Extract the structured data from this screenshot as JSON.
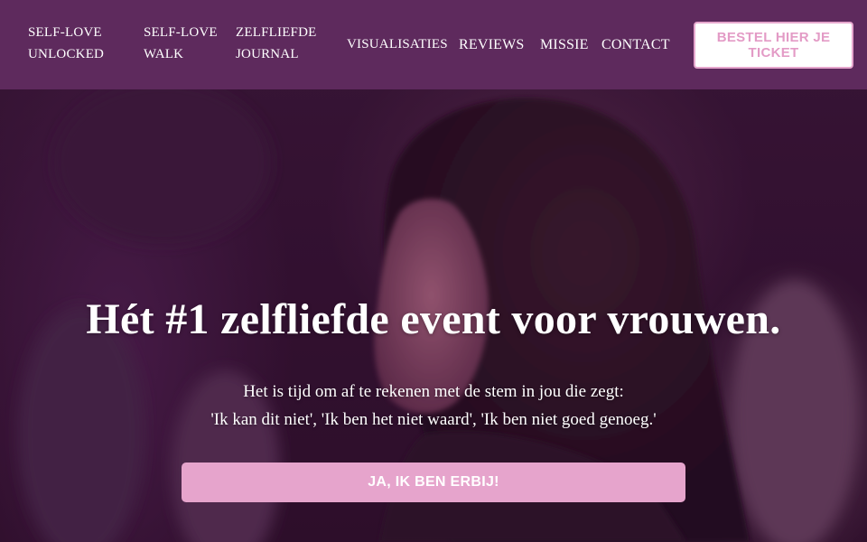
{
  "nav": {
    "items": [
      {
        "lines": [
          "SELF-LOVE",
          "UNLOCKED"
        ]
      },
      {
        "lines": [
          "SELF-LOVE",
          "WALK"
        ]
      },
      {
        "lines": [
          "ZELFLIEFDE",
          "JOURNAL"
        ]
      },
      {
        "lines": [
          "VISUALISATIES"
        ]
      },
      {
        "lines": [
          "REVIEWS"
        ]
      },
      {
        "lines": [
          "MISSIE"
        ]
      },
      {
        "lines": [
          "CONTACT"
        ]
      }
    ],
    "ticket_button": "BESTEL HIER JE TICKET"
  },
  "hero": {
    "headline": "Hét #1 zelfliefde event voor vrouwen.",
    "subtext_line1": "Het is tijd om af te rekenen met de stem in jou die zegt:",
    "subtext_line2": "'Ik kan dit niet', 'Ik ben het niet waard', 'Ik ben niet goed genoeg.'",
    "cta": "JA, IK BEN ERBIJ!"
  },
  "colors": {
    "navbar": "#5e2a5d",
    "accent_pink": "#e6a4cc",
    "ticket_text": "#e39bc6"
  }
}
